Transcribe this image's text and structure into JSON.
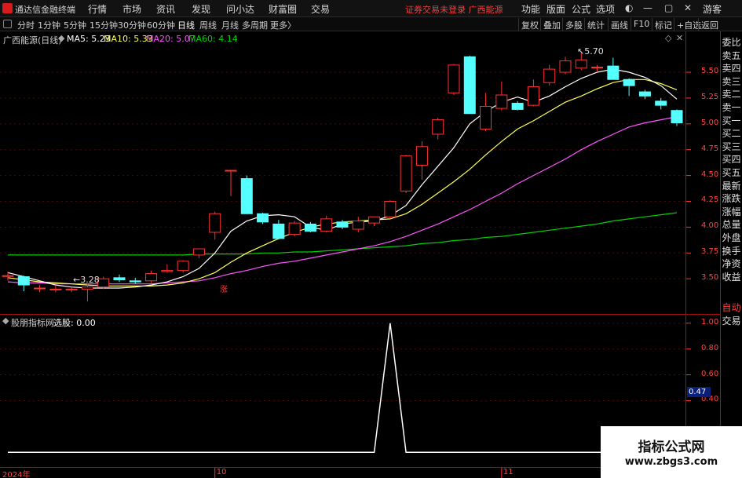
{
  "app": {
    "title": "通达信金融终端",
    "menu": [
      "行情",
      "市场",
      "资讯",
      "发现",
      "问小达",
      "财富圈",
      "交易"
    ],
    "status": "证券交易未登录   广西能源",
    "right_menu": [
      "功能",
      "版面",
      "公式",
      "选项"
    ],
    "guest": "游客"
  },
  "toolbar": {
    "periods": [
      "分时",
      "1分钟",
      "5分钟",
      "15分钟",
      "30分钟",
      "60分钟",
      "日线",
      "周线",
      "月线",
      "多周期",
      "更多〉"
    ],
    "active_period": "日线",
    "right_buttons": [
      "复权",
      "叠加",
      "多股",
      "统计",
      "画线",
      "F10",
      "标记",
      "+自选",
      "返回"
    ]
  },
  "stock_info": {
    "name": "广西能源(日线)",
    "ma5": "MA5: 5.23",
    "ma10": "MA10: 5.33",
    "ma20": "MA20: 5.07",
    "ma60": "MA60: 4.14"
  },
  "indicator_info": {
    "name": "股朋指标网",
    "value": "选股: 0.00"
  },
  "annotations": {
    "high_label": "5.70",
    "low_label": "3.28",
    "zhang": "涨"
  },
  "price_axis": [
    "5.50",
    "5.25",
    "5.00",
    "4.75",
    "4.50",
    "4.25",
    "4.00",
    "3.75",
    "3.50"
  ],
  "indicator_axis": [
    "1.00",
    "0.80",
    "0.60",
    "0.40"
  ],
  "indicator_highlight": "0.47",
  "date_axis": [
    "2024年",
    "10",
    "11"
  ],
  "side_panel": {
    "top": [
      "委比",
      "卖五",
      "卖四",
      "卖三",
      "卖二",
      "卖一",
      "买一",
      "买二",
      "买三",
      "买四",
      "买五",
      "最新",
      "涨跌",
      "涨幅",
      "总量",
      "外盘",
      "换手",
      "净资",
      "收益"
    ],
    "bottom": [
      "自动",
      "交易"
    ]
  },
  "colors": {
    "up": "#ff3232",
    "down": "#54ffff",
    "ma5": "#ffffff",
    "ma10": "#ffff54",
    "ma20": "#ff54ff",
    "ma60": "#00d200",
    "indicator": "#ffffff",
    "axis": "#ff3232"
  },
  "watermark": {
    "title": "指标公式网",
    "url": "www.zbgs3.com"
  },
  "chart_data": {
    "type": "candlestick",
    "ylim": [
      3.22,
      5.85
    ],
    "candles": [
      {
        "o": 3.53,
        "h": 3.57,
        "l": 3.48,
        "c": 3.53
      },
      {
        "o": 3.52,
        "h": 3.53,
        "l": 3.38,
        "c": 3.44
      },
      {
        "o": 3.41,
        "h": 3.44,
        "l": 3.37,
        "c": 3.41
      },
      {
        "o": 3.4,
        "h": 3.44,
        "l": 3.37,
        "c": 3.4
      },
      {
        "o": 3.4,
        "h": 3.42,
        "l": 3.37,
        "c": 3.4
      },
      {
        "o": 3.4,
        "h": 3.45,
        "l": 3.28,
        "c": 3.42
      },
      {
        "o": 3.42,
        "h": 3.52,
        "l": 3.4,
        "c": 3.5
      },
      {
        "o": 3.51,
        "h": 3.54,
        "l": 3.47,
        "c": 3.49
      },
      {
        "o": 3.48,
        "h": 3.51,
        "l": 3.45,
        "c": 3.47
      },
      {
        "o": 3.48,
        "h": 3.58,
        "l": 3.46,
        "c": 3.55
      },
      {
        "o": 3.57,
        "h": 3.64,
        "l": 3.56,
        "c": 3.58
      },
      {
        "o": 3.58,
        "h": 3.68,
        "l": 3.56,
        "c": 3.67
      },
      {
        "o": 3.73,
        "h": 3.79,
        "l": 3.7,
        "c": 3.79
      },
      {
        "o": 3.95,
        "h": 4.15,
        "l": 3.88,
        "c": 4.13
      },
      {
        "o": 4.55,
        "h": 4.55,
        "l": 4.3,
        "c": 4.55
      },
      {
        "o": 4.47,
        "h": 4.5,
        "l": 4.13,
        "c": 4.13
      },
      {
        "o": 4.13,
        "h": 4.14,
        "l": 4.03,
        "c": 4.05
      },
      {
        "o": 4.03,
        "h": 4.07,
        "l": 3.88,
        "c": 3.89
      },
      {
        "o": 3.93,
        "h": 4.06,
        "l": 3.91,
        "c": 4.04
      },
      {
        "o": 4.03,
        "h": 4.05,
        "l": 3.95,
        "c": 3.96
      },
      {
        "o": 3.96,
        "h": 4.11,
        "l": 3.95,
        "c": 4.08
      },
      {
        "o": 4.05,
        "h": 4.07,
        "l": 3.98,
        "c": 4.0
      },
      {
        "o": 3.98,
        "h": 4.1,
        "l": 3.95,
        "c": 4.06
      },
      {
        "o": 4.04,
        "h": 4.1,
        "l": 4.01,
        "c": 4.1
      },
      {
        "o": 4.1,
        "h": 4.26,
        "l": 4.08,
        "c": 4.25
      },
      {
        "o": 4.35,
        "h": 4.7,
        "l": 4.33,
        "c": 4.69
      },
      {
        "o": 4.6,
        "h": 4.83,
        "l": 4.46,
        "c": 4.78
      },
      {
        "o": 4.9,
        "h": 5.06,
        "l": 4.85,
        "c": 5.04
      },
      {
        "o": 5.3,
        "h": 5.58,
        "l": 5.28,
        "c": 5.57
      },
      {
        "o": 5.65,
        "h": 5.66,
        "l": 5.1,
        "c": 5.1
      },
      {
        "o": 4.95,
        "h": 5.3,
        "l": 4.93,
        "c": 5.17
      },
      {
        "o": 5.15,
        "h": 5.41,
        "l": 5.13,
        "c": 5.28
      },
      {
        "o": 5.2,
        "h": 5.22,
        "l": 5.13,
        "c": 5.14
      },
      {
        "o": 5.18,
        "h": 5.43,
        "l": 5.17,
        "c": 5.36
      },
      {
        "o": 5.4,
        "h": 5.57,
        "l": 5.37,
        "c": 5.53
      },
      {
        "o": 5.5,
        "h": 5.65,
        "l": 5.48,
        "c": 5.61
      },
      {
        "o": 5.54,
        "h": 5.7,
        "l": 5.52,
        "c": 5.62
      },
      {
        "o": 5.55,
        "h": 5.57,
        "l": 5.5,
        "c": 5.55
      },
      {
        "o": 5.56,
        "h": 5.64,
        "l": 5.43,
        "c": 5.43
      },
      {
        "o": 5.43,
        "h": 5.44,
        "l": 5.27,
        "c": 5.37
      },
      {
        "o": 5.31,
        "h": 5.33,
        "l": 5.24,
        "c": 5.27
      },
      {
        "o": 5.22,
        "h": 5.25,
        "l": 5.14,
        "c": 5.18
      },
      {
        "o": 5.13,
        "h": 5.14,
        "l": 4.98,
        "c": 5.01
      }
    ],
    "ma5": [
      3.56,
      3.52,
      3.48,
      3.44,
      3.42,
      3.41,
      3.41,
      3.41,
      3.42,
      3.44,
      3.47,
      3.52,
      3.6,
      3.75,
      3.96,
      4.06,
      4.11,
      4.12,
      4.1,
      4.0,
      3.97,
      4.03,
      4.05,
      4.06,
      4.11,
      4.21,
      4.41,
      4.59,
      4.77,
      5.0,
      5.12,
      5.21,
      5.26,
      5.21,
      5.27,
      5.36,
      5.44,
      5.5,
      5.53,
      5.5,
      5.45,
      5.37,
      5.24
    ],
    "ma10": [
      3.51,
      3.49,
      3.47,
      3.46,
      3.45,
      3.44,
      3.43,
      3.43,
      3.43,
      3.43,
      3.44,
      3.46,
      3.5,
      3.56,
      3.66,
      3.75,
      3.82,
      3.89,
      3.95,
      4.0,
      4.03,
      4.05,
      4.06,
      4.07,
      4.08,
      4.13,
      4.22,
      4.33,
      4.44,
      4.56,
      4.7,
      4.83,
      4.95,
      5.03,
      5.12,
      5.21,
      5.27,
      5.34,
      5.4,
      5.43,
      5.43,
      5.39,
      5.33
    ],
    "ma20": [
      3.47,
      3.46,
      3.46,
      3.45,
      3.45,
      3.45,
      3.45,
      3.45,
      3.45,
      3.45,
      3.46,
      3.47,
      3.48,
      3.51,
      3.55,
      3.58,
      3.62,
      3.65,
      3.67,
      3.7,
      3.73,
      3.76,
      3.79,
      3.82,
      3.86,
      3.91,
      3.97,
      4.03,
      4.1,
      4.17,
      4.25,
      4.33,
      4.42,
      4.5,
      4.58,
      4.66,
      4.75,
      4.83,
      4.9,
      4.97,
      5.01,
      5.04,
      5.07
    ],
    "ma60": [
      3.73,
      3.73,
      3.73,
      3.73,
      3.73,
      3.73,
      3.73,
      3.73,
      3.73,
      3.73,
      3.73,
      3.73,
      3.74,
      3.74,
      3.74,
      3.74,
      3.75,
      3.75,
      3.76,
      3.76,
      3.77,
      3.78,
      3.79,
      3.8,
      3.81,
      3.82,
      3.84,
      3.85,
      3.87,
      3.88,
      3.9,
      3.91,
      3.93,
      3.95,
      3.97,
      3.99,
      4.01,
      4.03,
      4.06,
      4.08,
      4.1,
      4.12,
      4.14
    ],
    "indicator": {
      "name": "选股",
      "ylim": [
        -0.12,
        1.12
      ],
      "values": [
        0,
        0,
        0,
        0,
        0,
        0,
        0,
        0,
        0,
        0,
        0,
        0,
        0,
        0,
        0,
        0,
        0,
        0,
        0,
        0,
        0,
        0,
        0,
        0,
        1,
        0,
        0,
        0,
        0,
        0,
        0,
        0,
        0,
        0,
        0,
        0,
        0,
        0,
        0,
        0,
        0,
        0,
        0
      ]
    }
  }
}
